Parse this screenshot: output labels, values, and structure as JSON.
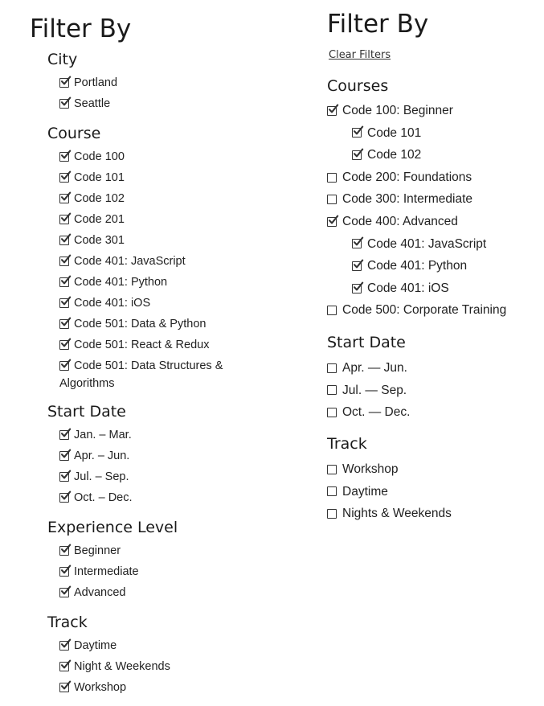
{
  "left": {
    "title": "Filter By",
    "city": {
      "heading": "City",
      "items": [
        {
          "label": "Portland",
          "checked": true
        },
        {
          "label": "Seattle",
          "checked": true
        }
      ]
    },
    "course": {
      "heading": "Course",
      "items": [
        {
          "label": "Code 100",
          "checked": true
        },
        {
          "label": "Code 101",
          "checked": true
        },
        {
          "label": "Code 102",
          "checked": true
        },
        {
          "label": "Code 201",
          "checked": true
        },
        {
          "label": "Code 301",
          "checked": true
        },
        {
          "label": "Code 401: JavaScript",
          "checked": true
        },
        {
          "label": "Code 401: Python",
          "checked": true
        },
        {
          "label": "Code 401: iOS",
          "checked": true
        },
        {
          "label": "Code 501: Data & Python",
          "checked": true
        },
        {
          "label": "Code 501: React & Redux",
          "checked": true
        },
        {
          "label": "Code 501: Data Structures &",
          "label_cont": "Algorithms",
          "checked": true
        }
      ]
    },
    "start_date": {
      "heading": "Start Date",
      "items": [
        {
          "label": "Jan. – Mar.",
          "checked": true
        },
        {
          "label": "Apr. – Jun.",
          "checked": true
        },
        {
          "label": "Jul. – Sep.",
          "checked": true
        },
        {
          "label": "Oct. – Dec.",
          "checked": true
        }
      ]
    },
    "experience": {
      "heading": "Experience Level",
      "items": [
        {
          "label": "Beginner",
          "checked": true
        },
        {
          "label": "Intermediate",
          "checked": true
        },
        {
          "label": "Advanced",
          "checked": true
        }
      ]
    },
    "track": {
      "heading": "Track",
      "items": [
        {
          "label": "Daytime",
          "checked": true
        },
        {
          "label": "Night & Weekends",
          "checked": true
        },
        {
          "label": "Workshop",
          "checked": true
        }
      ]
    }
  },
  "right": {
    "title": "Filter By",
    "clear_filters": "Clear Filters",
    "courses": {
      "heading": "Courses",
      "items": [
        {
          "label": "Code 100: Beginner",
          "checked": true
        },
        {
          "label": "Code 101",
          "checked": true
        },
        {
          "label": "Code 102",
          "checked": true
        },
        {
          "label": "Code 200: Foundations",
          "checked": false
        },
        {
          "label": "Code 300: Intermediate",
          "checked": false
        },
        {
          "label": "Code 400: Advanced",
          "checked": true
        },
        {
          "label": "Code 401: JavaScript",
          "checked": true
        },
        {
          "label": "Code 401: Python",
          "checked": true
        },
        {
          "label": "Code 401: iOS",
          "checked": true
        },
        {
          "label": "Code 500: Corporate Training",
          "checked": false
        }
      ]
    },
    "start_date": {
      "heading": "Start Date",
      "items": [
        {
          "label": "Apr. — Jun.",
          "checked": false
        },
        {
          "label": "Jul. — Sep.",
          "checked": false
        },
        {
          "label": "Oct. — Dec.",
          "checked": false
        }
      ]
    },
    "track": {
      "heading": "Track",
      "items": [
        {
          "label": "Workshop",
          "checked": false
        },
        {
          "label": "Daytime",
          "checked": false
        },
        {
          "label": "Nights & Weekends",
          "checked": false
        }
      ]
    }
  }
}
